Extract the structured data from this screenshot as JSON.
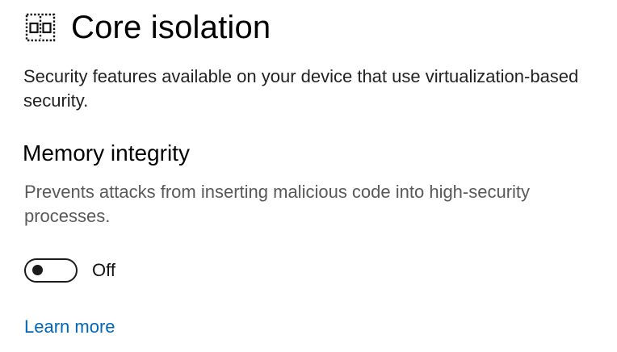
{
  "header": {
    "icon": "core-isolation-icon",
    "title": "Core isolation"
  },
  "description": "Security features available on your device that use virtualization-based security.",
  "memory_integrity": {
    "title": "Memory integrity",
    "description": "Prevents attacks from inserting malicious code into high-security processes.",
    "toggle": {
      "state": "off",
      "label": "Off"
    }
  },
  "links": {
    "learn_more": "Learn more"
  },
  "colors": {
    "link": "#0067b8",
    "secondary_text": "#595959",
    "toggle_border": "#1b1b1b"
  }
}
